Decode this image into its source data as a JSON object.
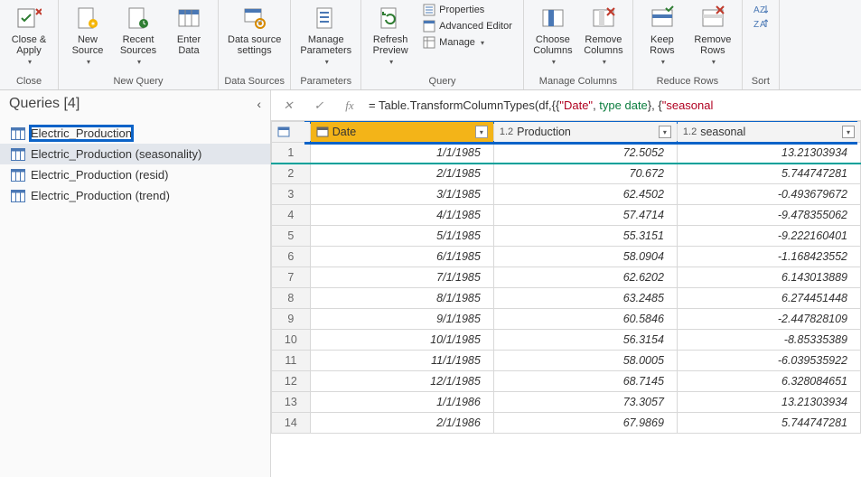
{
  "ribbon": {
    "close": {
      "close_apply": "Close &\nApply",
      "group": "Close"
    },
    "new_query": {
      "new_source": "New\nSource",
      "recent_sources": "Recent\nSources",
      "enter_data": "Enter\nData",
      "group": "New Query"
    },
    "data_sources": {
      "btn": "Data source\nsettings",
      "group": "Data Sources"
    },
    "parameters": {
      "btn": "Manage\nParameters",
      "group": "Parameters"
    },
    "query": {
      "refresh": "Refresh\nPreview",
      "properties": "Properties",
      "advanced": "Advanced Editor",
      "manage": "Manage",
      "group": "Query"
    },
    "manage_columns": {
      "choose": "Choose\nColumns",
      "remove": "Remove\nColumns",
      "group": "Manage Columns"
    },
    "reduce_rows": {
      "keep": "Keep\nRows",
      "remove": "Remove\nRows",
      "group": "Reduce Rows"
    },
    "sort": {
      "group": "Sort"
    }
  },
  "queries": {
    "title": "Queries [4]",
    "items": [
      {
        "name": "Electric_Production",
        "selected": false,
        "highlight": true
      },
      {
        "name": "Electric_Production (seasonality)",
        "selected": true,
        "highlight": false
      },
      {
        "name": "Electric_Production (resid)",
        "selected": false,
        "highlight": false
      },
      {
        "name": "Electric_Production (trend)",
        "selected": false,
        "highlight": false
      }
    ]
  },
  "formula": {
    "prefix": "= Table.TransformColumnTypes(df,{{",
    "s1": "\"Date\"",
    "mid1": ", ",
    "t1": "type date",
    "mid2": "}, {",
    "s2": "\"seasonal",
    "tail": ""
  },
  "columns": [
    {
      "name": "Date",
      "type_icon": "cal",
      "type_label": ""
    },
    {
      "name": "Production",
      "type_icon": "num",
      "type_label": "1.2"
    },
    {
      "name": "seasonal",
      "type_icon": "num",
      "type_label": "1.2"
    }
  ],
  "rows": [
    {
      "n": 1,
      "date": "1/1/1985",
      "production": "72.5052",
      "seasonal": "13.21303934"
    },
    {
      "n": 2,
      "date": "2/1/1985",
      "production": "70.672",
      "seasonal": "5.744747281"
    },
    {
      "n": 3,
      "date": "3/1/1985",
      "production": "62.4502",
      "seasonal": "-0.493679672"
    },
    {
      "n": 4,
      "date": "4/1/1985",
      "production": "57.4714",
      "seasonal": "-9.478355062"
    },
    {
      "n": 5,
      "date": "5/1/1985",
      "production": "55.3151",
      "seasonal": "-9.222160401"
    },
    {
      "n": 6,
      "date": "6/1/1985",
      "production": "58.0904",
      "seasonal": "-1.168423552"
    },
    {
      "n": 7,
      "date": "7/1/1985",
      "production": "62.6202",
      "seasonal": "6.143013889"
    },
    {
      "n": 8,
      "date": "8/1/1985",
      "production": "63.2485",
      "seasonal": "6.274451448"
    },
    {
      "n": 9,
      "date": "9/1/1985",
      "production": "60.5846",
      "seasonal": "-2.447828109"
    },
    {
      "n": 10,
      "date": "10/1/1985",
      "production": "56.3154",
      "seasonal": "-8.85335389"
    },
    {
      "n": 11,
      "date": "11/1/1985",
      "production": "58.0005",
      "seasonal": "-6.039535922"
    },
    {
      "n": 12,
      "date": "12/1/1985",
      "production": "68.7145",
      "seasonal": "6.328084651"
    },
    {
      "n": 13,
      "date": "1/1/1986",
      "production": "73.3057",
      "seasonal": "13.21303934"
    },
    {
      "n": 14,
      "date": "2/1/1986",
      "production": "67.9869",
      "seasonal": "5.744747281"
    }
  ]
}
